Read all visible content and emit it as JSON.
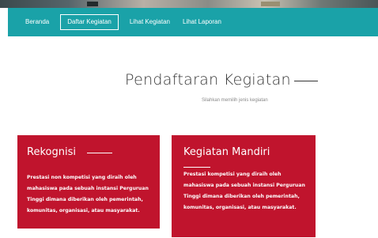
{
  "nav": {
    "items": [
      {
        "label": "Beranda"
      },
      {
        "label": "Daftar Kegiatan"
      },
      {
        "label": "Lihat Kegiatan"
      },
      {
        "label": "Lihat Laporan"
      }
    ],
    "active_index": 1,
    "background_color": "#1aa2a8"
  },
  "header": {
    "title": "Pendaftaran Kegiatan",
    "subtitle": "Silahkan memilih jenis kegiatan"
  },
  "cards": [
    {
      "title": "Rekognisi",
      "lines": [
        "Prestasi non kompetisi yang diraih oleh",
        "mahasiswa pada sebuah instansi Perguruan",
        "Tinggi dimana diberikan oleh pemerintah,",
        "komunitas, organisasi, atau masyarakat."
      ]
    },
    {
      "title": "Kegiatan Mandiri",
      "lines": [
        "Prestasi kompetisi yang diraih oleh",
        "mahasiswa pada sebuah instansi Perguruan",
        "Tinggi dimana diberikan oleh pemerintah,",
        "komunitas, organisasi, atau masyarakat."
      ]
    }
  ],
  "colors": {
    "card_background": "#c0142d",
    "card_text": "#ffffff"
  }
}
